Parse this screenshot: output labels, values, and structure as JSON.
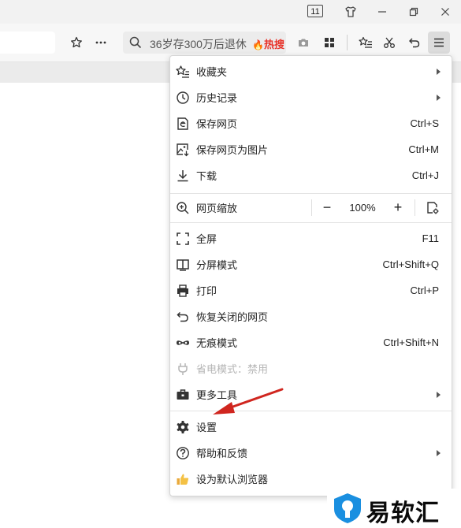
{
  "titlebar": {
    "tab_count": "11",
    "icons": [
      "tab-count-icon",
      "shirt-icon",
      "minimize-icon",
      "restore-icon",
      "close-icon"
    ]
  },
  "toolbar": {
    "search_text": "36岁存300万后退休",
    "hot_tag": "热搜",
    "icons": [
      "bookmark-star-icon",
      "more-dots-icon",
      "search-icon",
      "camera-icon",
      "apps-grid-icon",
      "favorites-list-icon",
      "scissors-icon",
      "undo-icon",
      "menu-icon"
    ]
  },
  "menu": {
    "items": [
      {
        "label": "收藏夹",
        "shortcut": "",
        "icon": "star-list-icon",
        "submenu": true
      },
      {
        "label": "历史记录",
        "shortcut": "",
        "icon": "clock-icon",
        "submenu": true
      },
      {
        "label": "保存网页",
        "shortcut": "Ctrl+S",
        "icon": "save-page-icon",
        "submenu": false
      },
      {
        "label": "保存网页为图片",
        "shortcut": "Ctrl+M",
        "icon": "save-image-icon",
        "submenu": false
      },
      {
        "label": "下载",
        "shortcut": "Ctrl+J",
        "icon": "download-icon",
        "submenu": false
      }
    ],
    "zoom": {
      "label": "网页缩放",
      "minus": "−",
      "value": "100%",
      "plus": "+",
      "icon": "zoom-icon"
    },
    "items2": [
      {
        "label": "全屏",
        "shortcut": "F11",
        "icon": "fullscreen-icon"
      },
      {
        "label": "分屏模式",
        "shortcut": "Ctrl+Shift+Q",
        "icon": "split-screen-icon"
      },
      {
        "label": "打印",
        "shortcut": "Ctrl+P",
        "icon": "printer-icon"
      },
      {
        "label": "恢复关闭的网页",
        "shortcut": "",
        "icon": "restore-tab-icon"
      },
      {
        "label": "无痕模式",
        "shortcut": "Ctrl+Shift+N",
        "icon": "incognito-icon"
      },
      {
        "label": "省电模式：禁用",
        "shortcut": "",
        "icon": "power-plug-icon",
        "disabled": true
      },
      {
        "label": "更多工具",
        "shortcut": "",
        "icon": "toolbox-icon",
        "submenu": true
      }
    ],
    "items3": [
      {
        "label": "设置",
        "icon": "gear-icon"
      },
      {
        "label": "帮助和反馈",
        "icon": "help-icon",
        "submenu": true
      },
      {
        "label": "设为默认浏览器",
        "icon": "thumbs-up-icon"
      }
    ]
  },
  "watermark": {
    "text": "易软汇"
  },
  "colors": {
    "hot_red": "#e8332a",
    "arrow_red": "#d0261f",
    "watermark_blue": "#1a8fe0"
  }
}
